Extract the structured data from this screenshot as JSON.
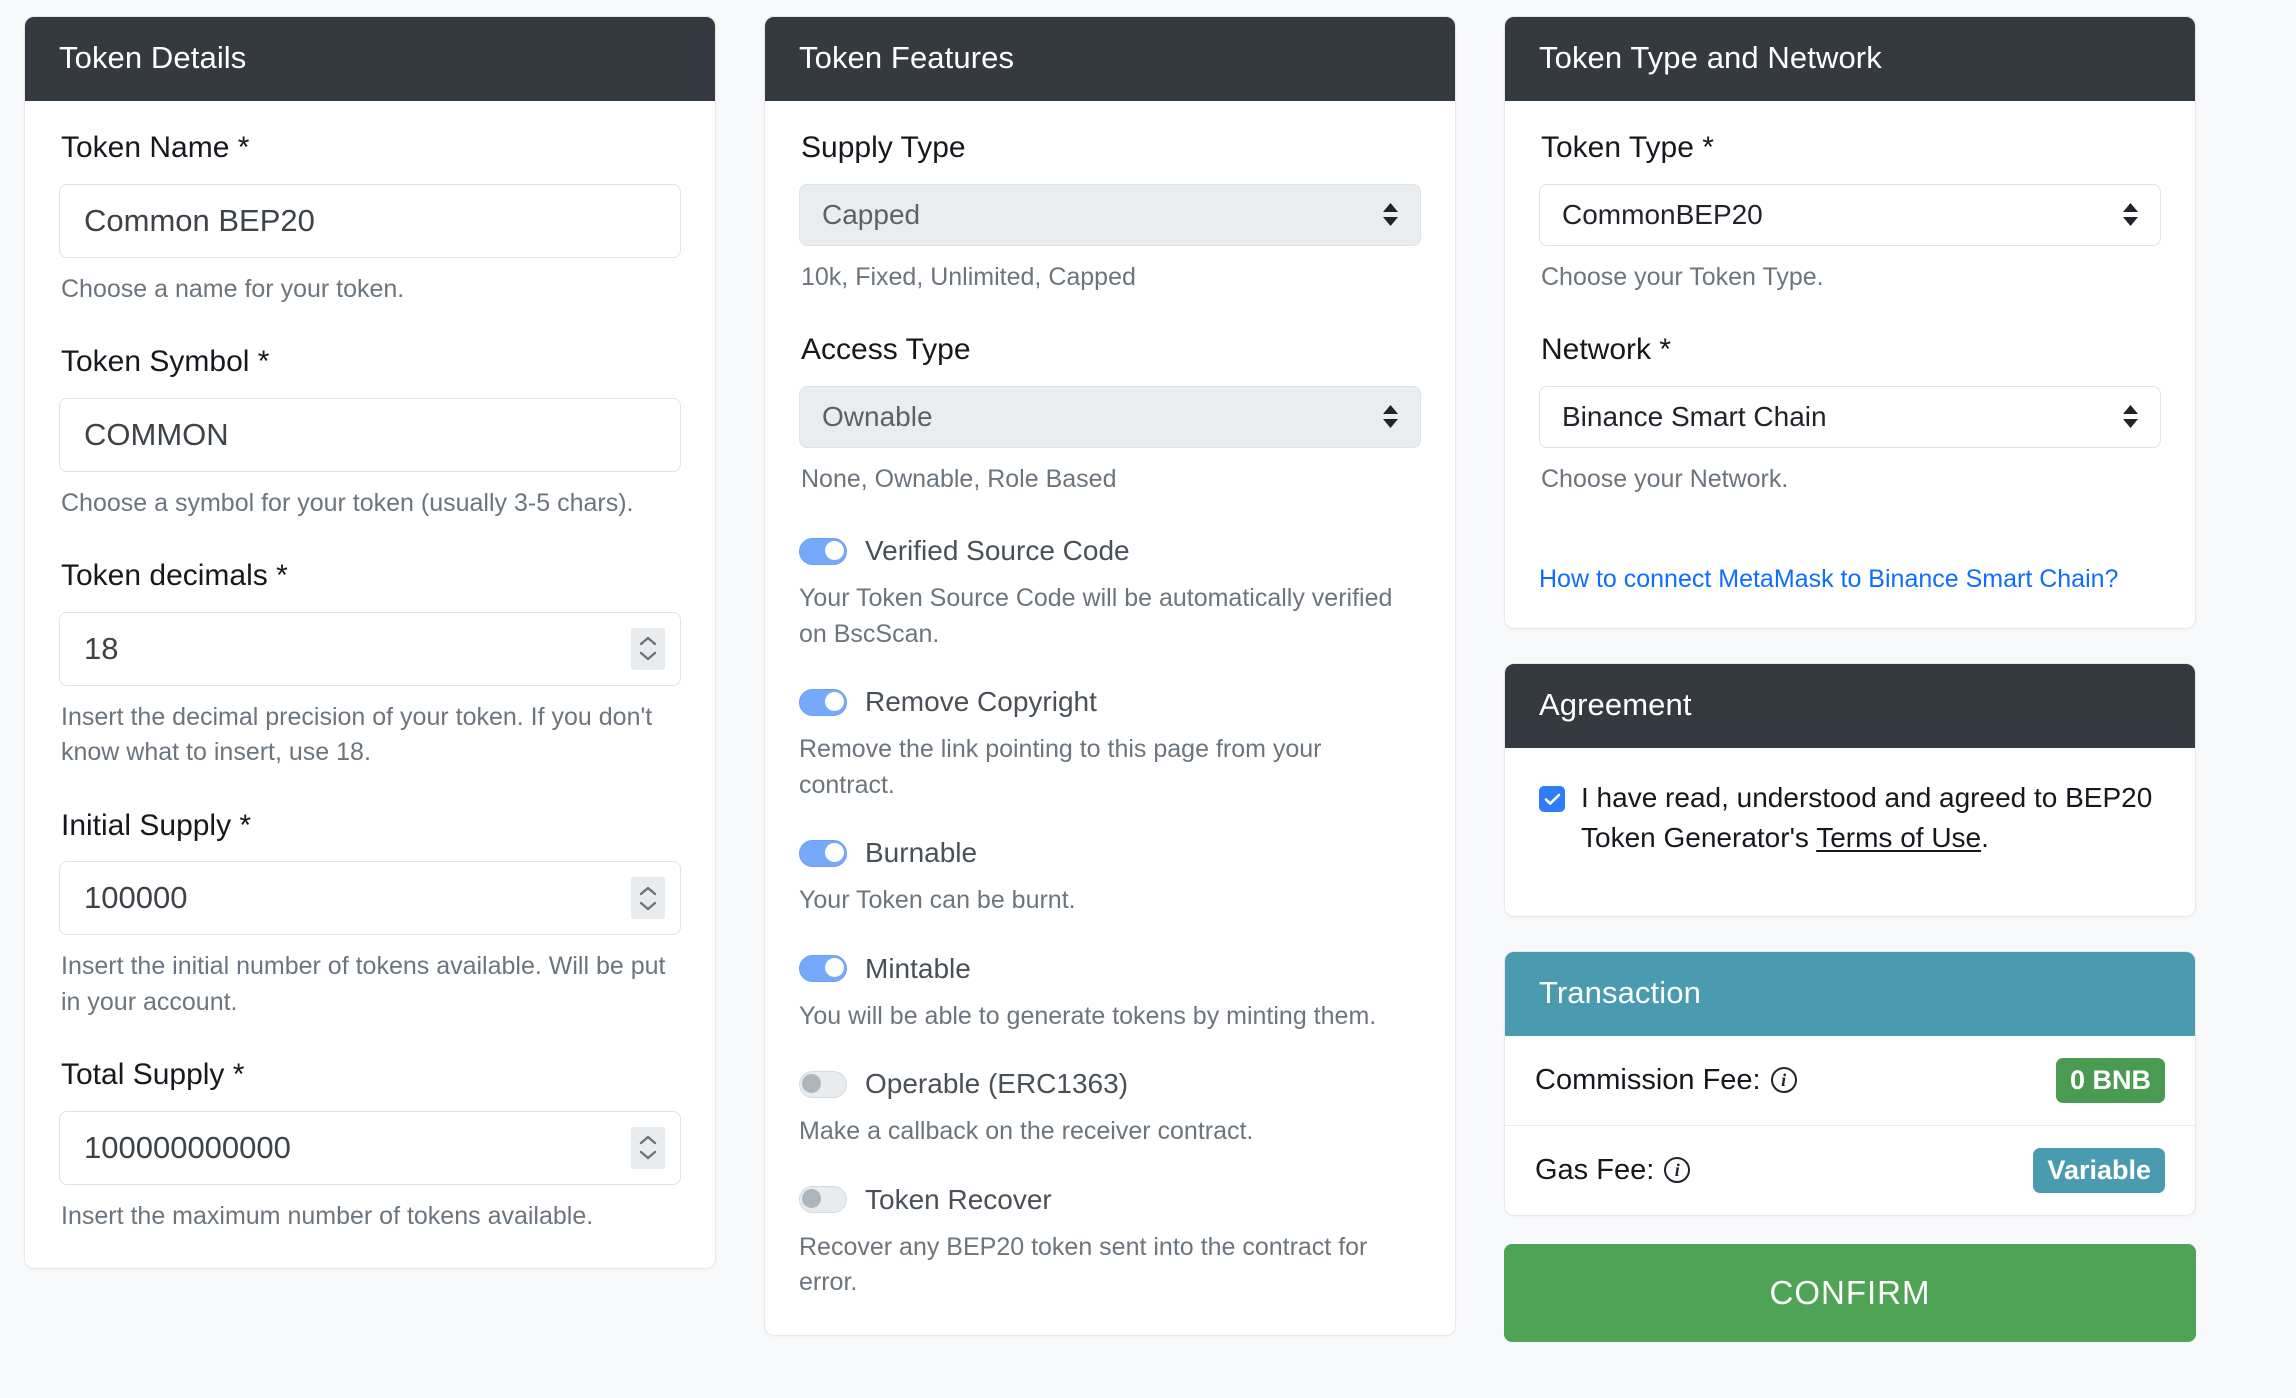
{
  "colors": {
    "header_dark": "#343a40",
    "header_teal": "#4a9bb0",
    "accent_blue": "#0d6efd",
    "toggle_on": "#76a9fa",
    "confirm_green": "#4fa354",
    "badge_green": "#4a9a52",
    "page_bg": "#f8f9fa"
  },
  "token_details": {
    "title": "Token Details",
    "fields": [
      {
        "label": "Token Name *",
        "value": "Common BEP20",
        "helper": "Choose a name for your token.",
        "type": "text"
      },
      {
        "label": "Token Symbol *",
        "value": "COMMON",
        "helper": "Choose a symbol for your token (usually 3-5 chars).",
        "type": "text"
      },
      {
        "label": "Token decimals *",
        "value": "18",
        "helper": "Insert the decimal precision of your token. If you don't know what to insert, use 18.",
        "type": "number"
      },
      {
        "label": "Initial Supply *",
        "value": "100000",
        "helper": "Insert the initial number of tokens available. Will be put in your account.",
        "type": "number"
      },
      {
        "label": "Total Supply *",
        "value": "100000000000",
        "helper": "Insert the maximum number of tokens available.",
        "type": "number"
      }
    ]
  },
  "token_features": {
    "title": "Token Features",
    "selects": [
      {
        "label": "Supply Type",
        "value": "Capped",
        "helper": "10k, Fixed, Unlimited, Capped",
        "options": [
          "10k",
          "Fixed",
          "Unlimited",
          "Capped"
        ]
      },
      {
        "label": "Access Type",
        "value": "Ownable",
        "helper": "None, Ownable, Role Based",
        "options": [
          "None",
          "Ownable",
          "Role Based"
        ]
      }
    ],
    "toggles": [
      {
        "label": "Verified Source Code",
        "on": true,
        "desc": "Your Token Source Code will be automatically verified on BscScan."
      },
      {
        "label": "Remove Copyright",
        "on": true,
        "desc": "Remove the link pointing to this page from your contract."
      },
      {
        "label": "Burnable",
        "on": true,
        "desc": "Your Token can be burnt."
      },
      {
        "label": "Mintable",
        "on": true,
        "desc": "You will be able to generate tokens by minting them."
      },
      {
        "label": "Operable (ERC1363)",
        "on": false,
        "desc": "Make a callback on the receiver contract."
      },
      {
        "label": "Token Recover",
        "on": false,
        "desc": "Recover any BEP20 token sent into the contract for error."
      }
    ]
  },
  "token_type_network": {
    "title": "Token Type and Network",
    "token_type": {
      "label": "Token Type *",
      "value": "CommonBEP20",
      "helper": "Choose your Token Type."
    },
    "network": {
      "label": "Network *",
      "value": "Binance Smart Chain",
      "helper": "Choose your Network."
    },
    "metamask_link": "How to connect MetaMask to Binance Smart Chain?"
  },
  "agreement": {
    "title": "Agreement",
    "checked": true,
    "text_before": "I have read, understood and agreed to BEP20 Token Generator's ",
    "link_text": "Terms of Use",
    "text_after": "."
  },
  "transaction": {
    "title": "Transaction",
    "rows": [
      {
        "label": "Commission Fee:",
        "badge": "0 BNB",
        "badge_style": "green"
      },
      {
        "label": "Gas Fee:",
        "badge": "Variable",
        "badge_style": "teal"
      }
    ]
  },
  "confirm_button": {
    "label": "CONFIRM"
  }
}
